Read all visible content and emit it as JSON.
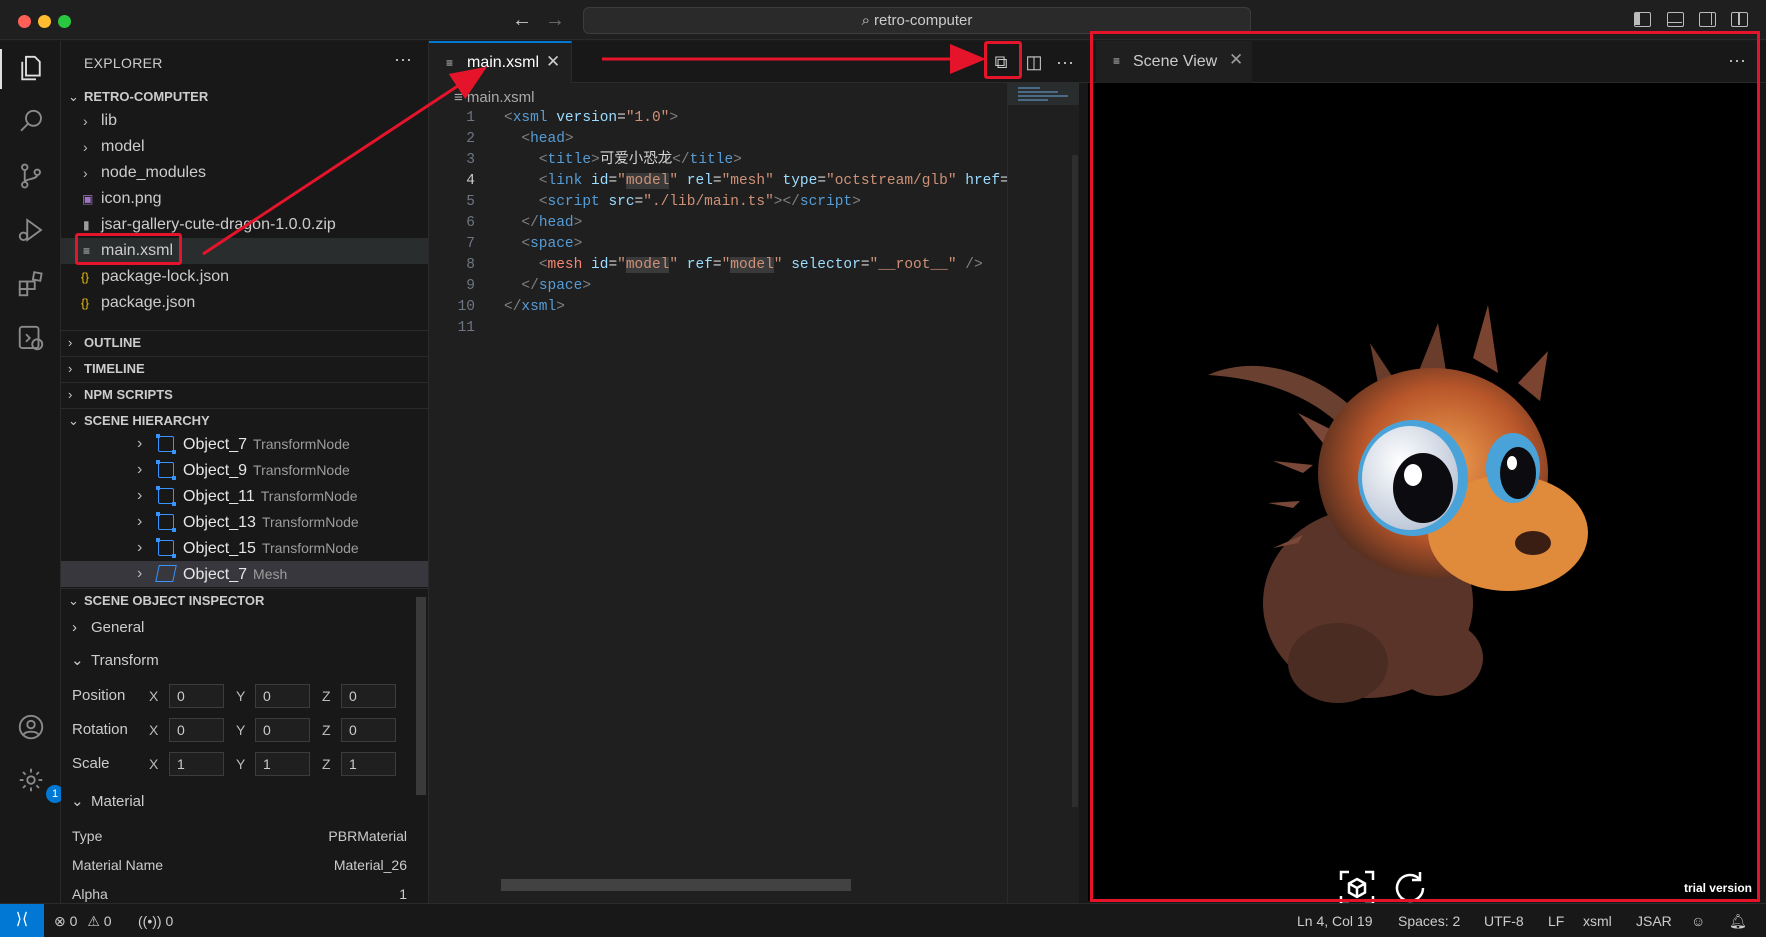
{
  "window": {
    "search_text": "retro-computer"
  },
  "explorer": {
    "title": "EXPLORER",
    "root": "RETRO-COMPUTER",
    "items": [
      {
        "label": "lib",
        "kind": "folder"
      },
      {
        "label": "model",
        "kind": "folder"
      },
      {
        "label": "node_modules",
        "kind": "folder"
      },
      {
        "label": "icon.png",
        "kind": "image"
      },
      {
        "label": "jsar-gallery-cute-dragon-1.0.0.zip",
        "kind": "zip"
      },
      {
        "label": "main.xsml",
        "kind": "file"
      },
      {
        "label": "package-lock.json",
        "kind": "json"
      },
      {
        "label": "package.json",
        "kind": "json"
      }
    ]
  },
  "sections": {
    "outline": "OUTLINE",
    "timeline": "TIMELINE",
    "npm_scripts": "NPM SCRIPTS",
    "scene_hierarchy": "SCENE HIERARCHY",
    "scene_object_inspector": "SCENE OBJECT INSPECTOR"
  },
  "hierarchy": [
    {
      "name": "Object_7",
      "type": "TransformNode"
    },
    {
      "name": "Object_9",
      "type": "TransformNode"
    },
    {
      "name": "Object_11",
      "type": "TransformNode"
    },
    {
      "name": "Object_13",
      "type": "TransformNode"
    },
    {
      "name": "Object_15",
      "type": "TransformNode"
    },
    {
      "name": "Object_7",
      "type": "Mesh"
    }
  ],
  "inspector": {
    "general": "General",
    "transform": "Transform",
    "axes": [
      "X",
      "Y",
      "Z"
    ],
    "rows": [
      {
        "label": "Position",
        "values": [
          "0",
          "0",
          "0"
        ]
      },
      {
        "label": "Rotation",
        "values": [
          "0",
          "0",
          "0"
        ]
      },
      {
        "label": "Scale",
        "values": [
          "1",
          "1",
          "1"
        ]
      }
    ],
    "material": "Material",
    "material_props": [
      {
        "key": "Type",
        "value": "PBRMaterial"
      },
      {
        "key": "Material Name",
        "value": "Material_26"
      },
      {
        "key": "Alpha",
        "value": "1"
      }
    ]
  },
  "editor": {
    "tab_label": "main.xsml",
    "breadcrumb": "main.xsml",
    "line_numbers": [
      "1",
      "2",
      "3",
      "4",
      "5",
      "6",
      "7",
      "8",
      "9",
      "10",
      "11"
    ],
    "current_line": 4
  },
  "scene_view": {
    "tab_label": "Scene View",
    "watermark": "trial version"
  },
  "status": {
    "errors": "0",
    "warnings": "0",
    "ports": "0",
    "cursor": "Ln 4, Col 19",
    "spaces": "Spaces: 2",
    "encoding": "UTF-8",
    "eol": "LF",
    "language": "xsml",
    "jsar": "JSAR"
  },
  "colors": {
    "accent": "#0078d4",
    "annotation_red": "#e5142a"
  }
}
